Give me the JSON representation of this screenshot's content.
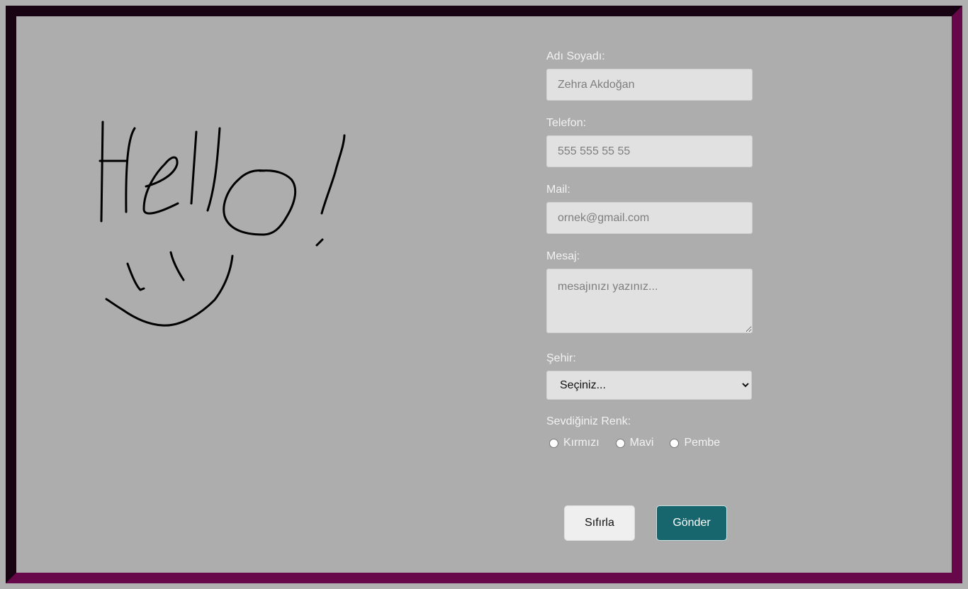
{
  "drawing": {
    "alt": "Hello! smiley face drawing"
  },
  "form": {
    "name": {
      "label": "Adı Soyadı:",
      "placeholder": "Zehra Akdoğan"
    },
    "phone": {
      "label": "Telefon:",
      "placeholder": "555 555 55 55"
    },
    "mail": {
      "label": "Mail:",
      "placeholder": "ornek@gmail.com"
    },
    "message": {
      "label": "Mesaj:",
      "placeholder": "mesajınızı yazınız..."
    },
    "city": {
      "label": "Şehir:",
      "selected": "Seçiniz..."
    },
    "color": {
      "label": "Sevdiğiniz Renk:",
      "options": [
        "Kırmızı",
        "Mavi",
        "Pembe"
      ]
    },
    "reset_label": "Sıfırla",
    "submit_label": "Gönder"
  },
  "colors": {
    "background": "#adadad",
    "frame_dark": "#170312",
    "frame_light": "#66084a",
    "submit": "#17666e"
  }
}
